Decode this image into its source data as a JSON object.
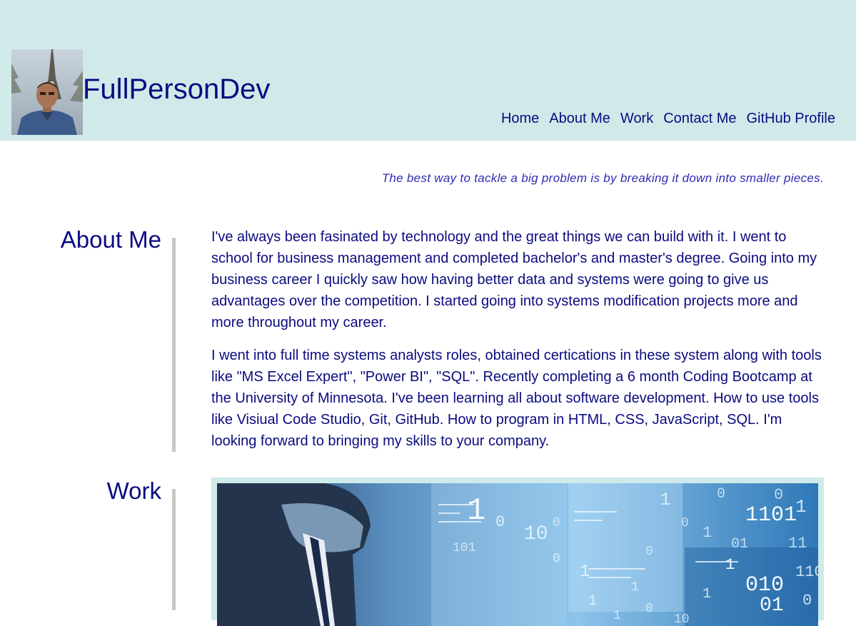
{
  "header": {
    "brand": "FullPersonDev",
    "nav": [
      "Home",
      "About Me",
      "Work",
      "Contact Me",
      "GitHub Profile"
    ]
  },
  "quote": "The best way to tackle a big problem is by breaking it down into smaller pieces.",
  "about": {
    "title": "About Me",
    "paragraphs": [
      "I've always been fasinated by technology and the great things we can build with it. I went to school for business management and completed bachelor's and master's degree. Going into my business career I quickly saw how having better data and systems were going to give us advantages over the competition. I started going into systems modification projects more and more throughout my career.",
      "I went into full time systems analysts roles, obtained certications in these system along with tools like \"MS Excel Expert\", \"Power BI\", \"SQL\". Recently completing a 6 month Coding Bootcamp at the University of Minnesota. I've been learning all about software development. How to use tools like Visiual Code Studio, Git, GitHub. How to program in HTML, CSS, JavaScript, SQL. I'm looking forward to bringing my skills to your company."
    ]
  },
  "work": {
    "title": "Work",
    "image_overlay_text": [
      "1",
      "0",
      "10",
      "1101",
      "1",
      "0",
      "0",
      "1",
      "0",
      "1",
      "01",
      "11",
      "0",
      "1",
      "1",
      "010",
      "01",
      "110",
      "1",
      "0",
      "1",
      "0",
      "10",
      "101",
      "0",
      "1",
      "1",
      "0"
    ]
  },
  "colors": {
    "header_bg": "#d0eaea",
    "text": "#0b0b80",
    "quote": "#2c2cb0",
    "divider": "#c8c8c8"
  }
}
